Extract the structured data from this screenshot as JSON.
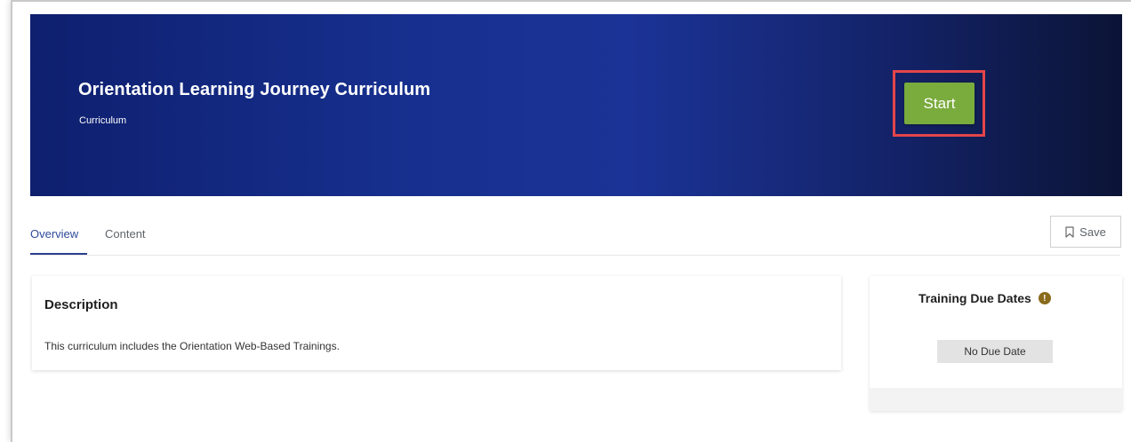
{
  "banner": {
    "title": "Orientation Learning Journey Curriculum",
    "subtitle": "Curriculum",
    "start_label": "Start"
  },
  "tabs": [
    {
      "label": "Overview",
      "active": true
    },
    {
      "label": "Content",
      "active": false
    }
  ],
  "save": {
    "label": "Save",
    "icon": "bookmark-icon"
  },
  "description": {
    "title": "Description",
    "text": "This curriculum includes the Orientation Web-Based Trainings."
  },
  "due_dates": {
    "title": "Training Due Dates",
    "info_icon": "info-icon",
    "info_glyph": "!",
    "value": "No Due Date"
  },
  "colors": {
    "banner_dark": "#0e1f6e",
    "start_green": "#7aab3d",
    "highlight_red": "#e4454a",
    "tab_active": "#2f4a9a"
  }
}
